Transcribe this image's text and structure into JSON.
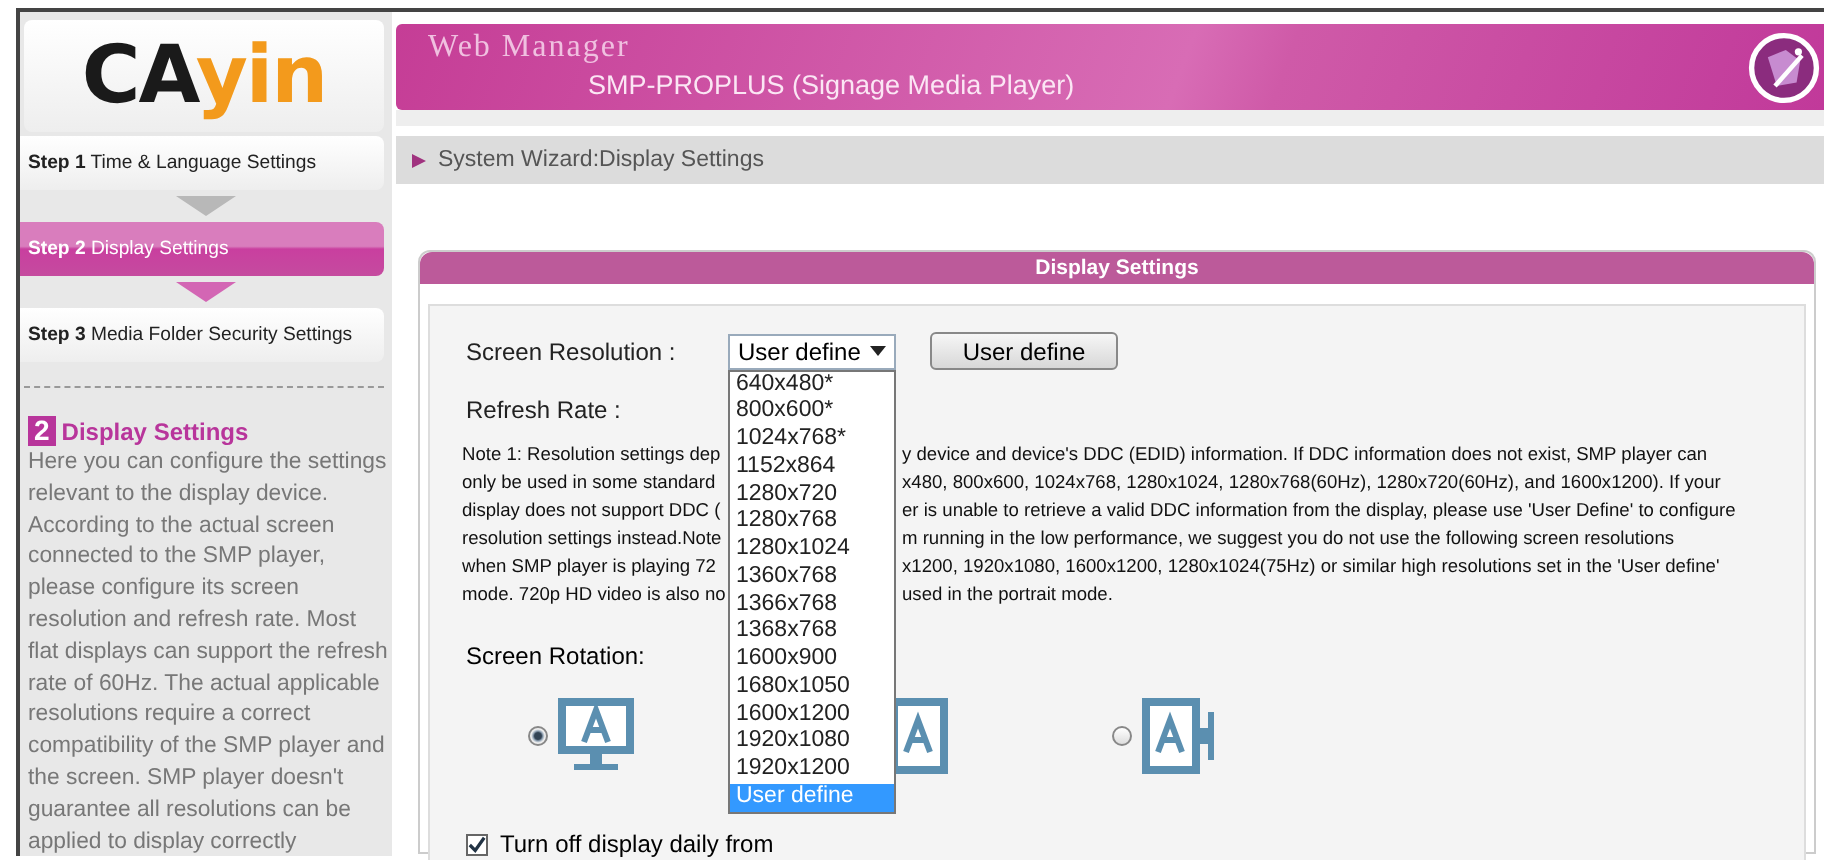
{
  "logo": {
    "parts": [
      "CA",
      "yin"
    ]
  },
  "header": {
    "title": "Web Manager",
    "subtitle": "SMP-PROPLUS (Signage Media Player)"
  },
  "steps": [
    {
      "number": "Step 1",
      "label": "Time & Language Settings",
      "selected": false
    },
    {
      "number": "Step 2",
      "label": "Display Settings",
      "selected": true
    },
    {
      "number": "Step 3",
      "label": "Media Folder Security Settings",
      "selected": false
    }
  ],
  "help": {
    "badge": "2",
    "title": "Display Settings",
    "text": "Here you can configure the settings relevant to the display device. According to the actual screen connected to the SMP player, please configure its screen resolution and refresh rate. Most flat displays can support the refresh rate of 60Hz. The actual applicable resolutions require a correct compatibility of the SMP player and the screen. SMP player doesn't guarantee all resolutions can be applied to display correctly"
  },
  "breadcrumb": "System Wizard:Display Settings",
  "panel": {
    "title": "Display Settings"
  },
  "resolution": {
    "label": "Screen Resolution :",
    "value": "User define",
    "button": "User define",
    "options": [
      {
        "label": "640x480*",
        "selected": false
      },
      {
        "label": "800x600*",
        "selected": false
      },
      {
        "label": "1024x768*",
        "selected": false
      },
      {
        "label": "1152x864",
        "selected": false
      },
      {
        "label": "1280x720",
        "selected": false
      },
      {
        "label": "1280x768",
        "selected": false
      },
      {
        "label": "1280x1024",
        "selected": false
      },
      {
        "label": "1360x768",
        "selected": false
      },
      {
        "label": "1366x768",
        "selected": false
      },
      {
        "label": "1368x768",
        "selected": false
      },
      {
        "label": "1600x900",
        "selected": false
      },
      {
        "label": "1680x1050",
        "selected": false
      },
      {
        "label": "1600x1200",
        "selected": false
      },
      {
        "label": "1920x1080",
        "selected": false
      },
      {
        "label": "1920x1200",
        "selected": false
      },
      {
        "label": "User define",
        "selected": true
      }
    ]
  },
  "refresh_rate": {
    "label": "Refresh Rate :"
  },
  "note_lines": [
    {
      "left": "Note 1: Resolution settings dep",
      "right": "y device and device's DDC (EDID) information. If DDC information does not exist, SMP player can"
    },
    {
      "left": "only be used in some standard",
      "right": "x480, 800x600, 1024x768, 1280x1024, 1280x768(60Hz), 1280x720(60Hz), and 1600x1200). If your"
    },
    {
      "left": "display does not support DDC (",
      "right": "er is unable to retrieve a valid DDC information from the display, please use 'User Define' to configure"
    },
    {
      "left": "resolution settings instead.Note",
      "right": "m running in the low performance, we suggest you do not use the following screen resolutions"
    },
    {
      "left": "when SMP player is playing 72",
      "right": "x1200, 1920x1080, 1600x1200, 1280x1024(75Hz) or similar high resolutions set in the 'User define'"
    },
    {
      "left": "mode. 720p HD video is also no",
      "right": "used in the portrait mode."
    }
  ],
  "rotation": {
    "label": "Screen Rotation:",
    "options": [
      {
        "kind": "landscape",
        "selected": true
      },
      {
        "kind": "portrait-left"
      },
      {
        "kind": "portrait-right",
        "selected": false
      }
    ]
  },
  "turn_off": {
    "label": "Turn off display daily from",
    "checked": true
  }
}
